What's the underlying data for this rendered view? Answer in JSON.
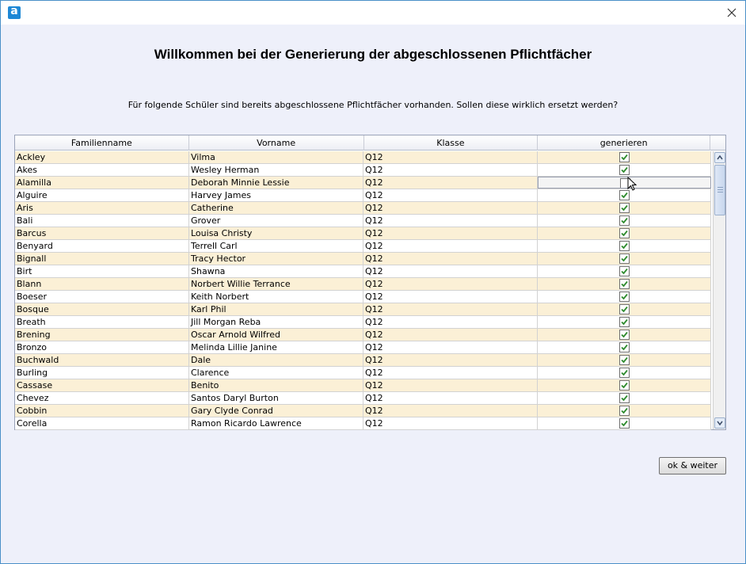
{
  "window": {
    "app_icon_letter": "a",
    "close_glyph": "×"
  },
  "heading": "Willkommen bei der Generierung der abgeschlossenen Pflichtfächer",
  "subtitle": "Für folgende Schüler sind bereits abgeschlossene Pflichtfächer vorhanden. Sollen diese wirklich ersetzt werden?",
  "table": {
    "columns": [
      "Familienname",
      "Vorname",
      "Klasse",
      "generieren"
    ],
    "rows": [
      {
        "last": "Ackley",
        "first": "Vilma",
        "class": "Q12",
        "checked": true
      },
      {
        "last": "Akes",
        "first": "Wesley Herman",
        "class": "Q12",
        "checked": true
      },
      {
        "last": "Alamilla",
        "first": "Deborah Minnie Lessie",
        "class": "Q12",
        "checked": false
      },
      {
        "last": "Alguire",
        "first": "Harvey James",
        "class": "Q12",
        "checked": true
      },
      {
        "last": "Aris",
        "first": "Catherine",
        "class": "Q12",
        "checked": true
      },
      {
        "last": "Bali",
        "first": "Grover",
        "class": "Q12",
        "checked": true
      },
      {
        "last": "Barcus",
        "first": "Louisa Christy",
        "class": "Q12",
        "checked": true
      },
      {
        "last": "Benyard",
        "first": "Terrell Carl",
        "class": "Q12",
        "checked": true
      },
      {
        "last": "Bignall",
        "first": "Tracy Hector",
        "class": "Q12",
        "checked": true
      },
      {
        "last": "Birt",
        "first": "Shawna",
        "class": "Q12",
        "checked": true
      },
      {
        "last": "Blann",
        "first": "Norbert Willie Terrance",
        "class": "Q12",
        "checked": true
      },
      {
        "last": "Boeser",
        "first": "Keith Norbert",
        "class": "Q12",
        "checked": true
      },
      {
        "last": "Bosque",
        "first": "Karl Phil",
        "class": "Q12",
        "checked": true
      },
      {
        "last": "Breath",
        "first": "Jill Morgan Reba",
        "class": "Q12",
        "checked": true
      },
      {
        "last": "Brening",
        "first": "Oscar Arnold Wilfred",
        "class": "Q12",
        "checked": true
      },
      {
        "last": "Bronzo",
        "first": "Melinda Lillie Janine",
        "class": "Q12",
        "checked": true
      },
      {
        "last": "Buchwald",
        "first": "Dale",
        "class": "Q12",
        "checked": true
      },
      {
        "last": "Burling",
        "first": "Clarence",
        "class": "Q12",
        "checked": true
      },
      {
        "last": "Cassase",
        "first": "Benito",
        "class": "Q12",
        "checked": true
      },
      {
        "last": "Chevez",
        "first": "Santos Daryl Burton",
        "class": "Q12",
        "checked": true
      },
      {
        "last": "Cobbin",
        "first": "Gary Clyde Conrad",
        "class": "Q12",
        "checked": true
      },
      {
        "last": "Corella",
        "first": "Ramon Ricardo Lawrence",
        "class": "Q12",
        "checked": true
      }
    ],
    "selected_row": 2
  },
  "buttons": {
    "ok": "ok & weiter"
  },
  "colors": {
    "row_alt": "#fbf0d6",
    "check_green": "#2e8b2e",
    "window_bg": "#eef0fa"
  }
}
